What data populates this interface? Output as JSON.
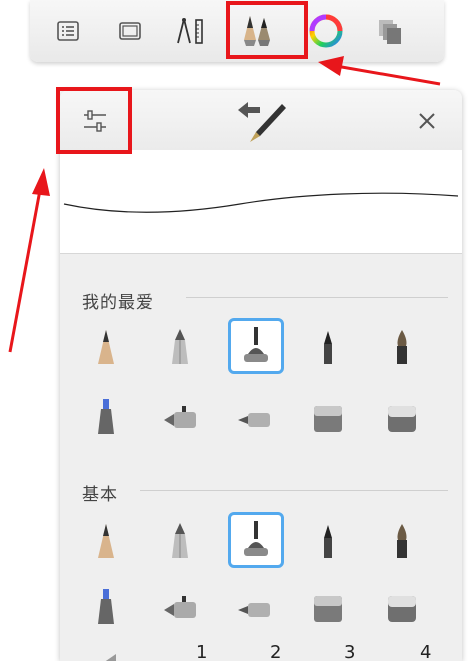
{
  "toolbar": {
    "items": [
      {
        "name": "list-icon"
      },
      {
        "name": "canvas-frame-icon"
      },
      {
        "name": "ruler-compass-icon"
      },
      {
        "name": "brushes-icon",
        "highlighted": true
      },
      {
        "name": "color-wheel-icon"
      },
      {
        "name": "layers-icon"
      }
    ]
  },
  "panel": {
    "header": {
      "left_icon": "sliders-icon",
      "center_icon": "brush-swap-icon",
      "close_icon": "close-icon"
    },
    "sections": [
      {
        "title": "我的最爱"
      },
      {
        "title": "基本"
      }
    ],
    "size_scale": [
      "1",
      "2",
      "3",
      "4"
    ]
  },
  "colors": {
    "annotation": "#e8161b",
    "selection": "#53a9ee",
    "panel_bg": "#efefef"
  }
}
